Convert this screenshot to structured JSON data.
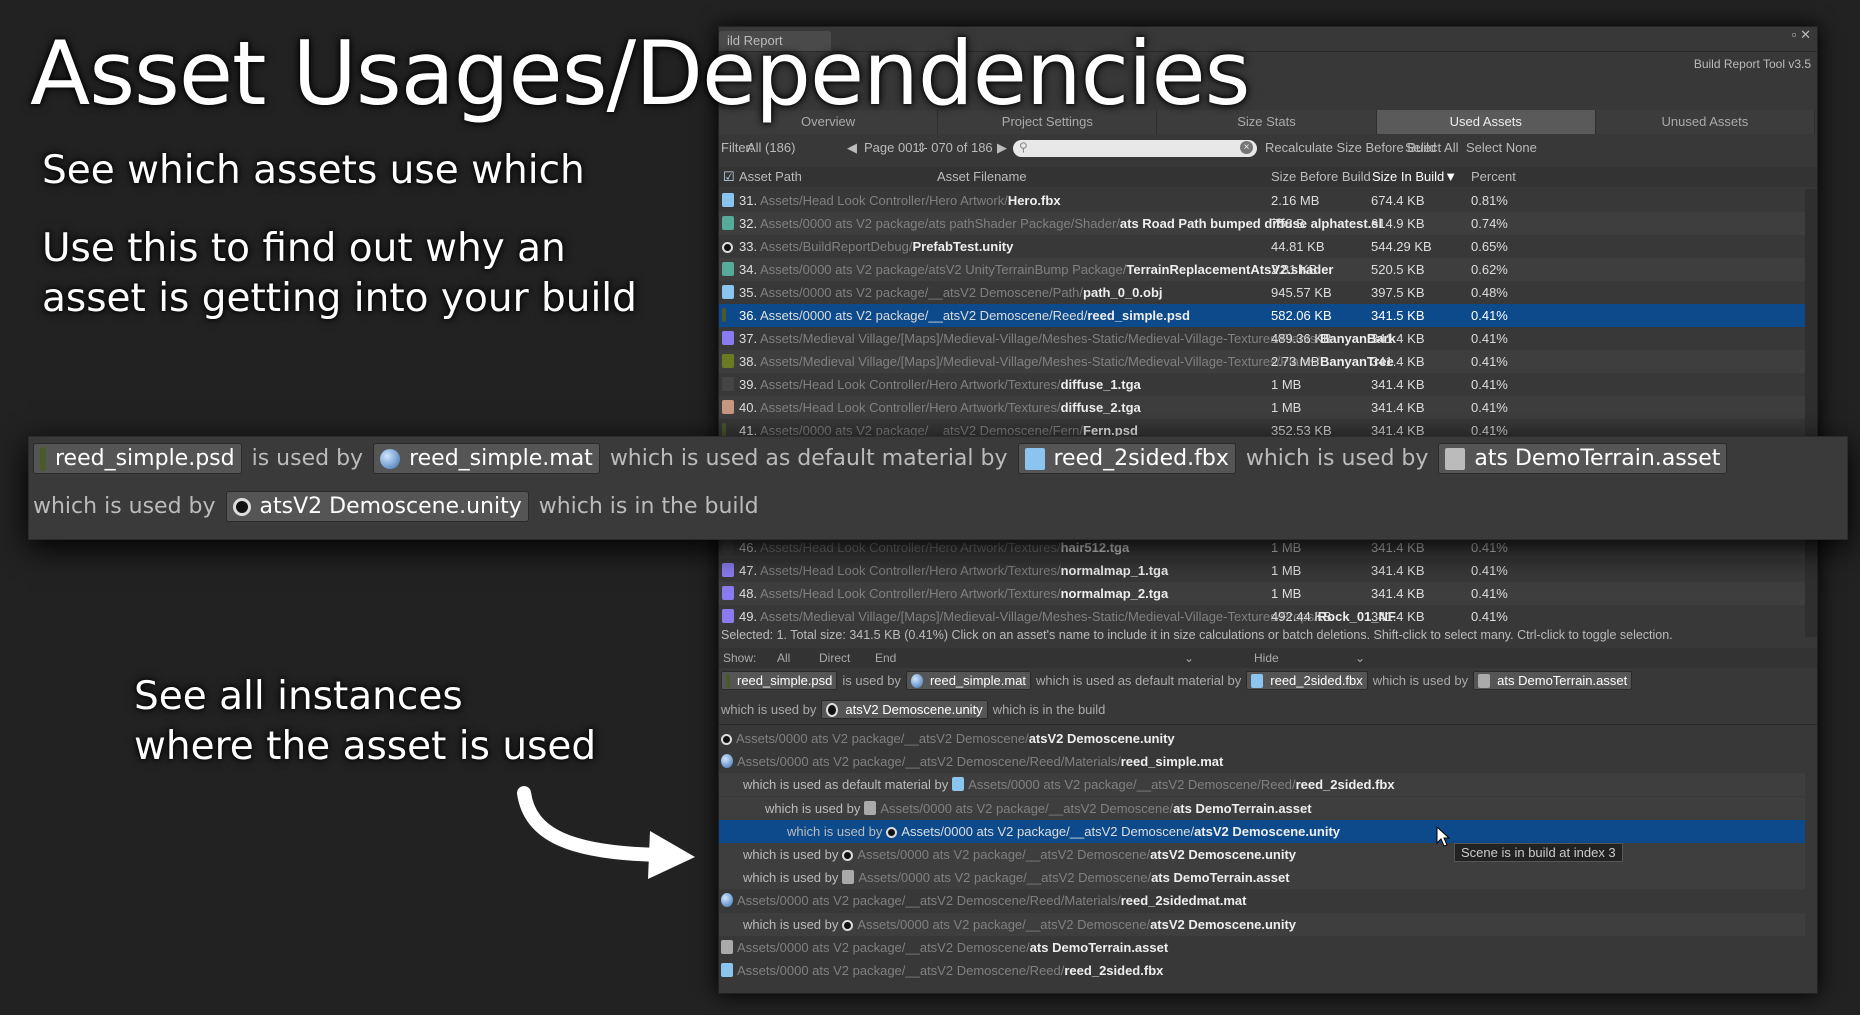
{
  "promo": {
    "title": "Asset Usages/Dependencies",
    "line1": "See which assets use which",
    "line2a": "Use this to find out why an",
    "line2b": "asset is getting into your build",
    "line3a": "See all instances",
    "line3b": "where the asset is used"
  },
  "window": {
    "tab": "ild Report",
    "version": "Build Report Tool v3.5",
    "tabs": [
      {
        "label": "Overview"
      },
      {
        "label": "Project Settings"
      },
      {
        "label": "Size Stats"
      },
      {
        "label": "Used Assets",
        "active": true
      },
      {
        "label": "Unused Assets"
      }
    ],
    "filter_label": "Filter:",
    "filter_value": "All (186)",
    "page": "Page 001 - 070 of 186",
    "search_placeholder": "",
    "recalc": "Recalculate Size Before Build",
    "select_all": "Select All",
    "select_none": "Select None",
    "columns": {
      "path": "Asset Path",
      "filename": "Asset Filename",
      "before": "Size Before Build",
      "inbuild": "Size In Build",
      "percent": "Percent"
    }
  },
  "rows": [
    {
      "n": "31.",
      "icon": "fbx",
      "dir": "Assets/Head Look Controller/Hero Artwork/",
      "file": "Hero.fbx",
      "before": "2.16 MB",
      "inbuild": "674.4 KB",
      "pct": "0.81%"
    },
    {
      "n": "32.",
      "icon": "shader",
      "dir": "Assets/0000 ats V2 package/ats pathShader Package/Shader/",
      "file": "ats Road Path bumped diffuse alphatest.sl",
      "before": "758 B",
      "inbuild": "614.9 KB",
      "pct": "0.74%"
    },
    {
      "n": "33.",
      "icon": "unity",
      "dir": "Assets/BuildReportDebug/",
      "file": "PrefabTest.unity",
      "before": "44.81 KB",
      "inbuild": "544.29 KB",
      "pct": "0.65%"
    },
    {
      "n": "34.",
      "icon": "shader",
      "dir": "Assets/0000 ats V2 package/atsV2 UnityTerrainBump Package/",
      "file": "TerrainReplacementAtsV2.shader",
      "before": "2.81 KB",
      "inbuild": "520.5 KB",
      "pct": "0.62%"
    },
    {
      "n": "35.",
      "icon": "fbx",
      "dir": "Assets/0000 ats V2 package/__atsV2 Demoscene/Path/",
      "file": "path_0_0.obj",
      "before": "945.57 KB",
      "inbuild": "397.5 KB",
      "pct": "0.48%"
    },
    {
      "n": "36.",
      "icon": "psd",
      "dir": "Assets/0000 ats V2 package/__atsV2 Demoscene/Reed/",
      "file": "reed_simple.psd",
      "before": "582.06 KB",
      "inbuild": "341.5 KB",
      "pct": "0.41%",
      "selected": true
    },
    {
      "n": "37.",
      "icon": "tex",
      "dir": "Assets/Medieval Village/[Maps]/Medieval-Village/Meshes-Static/Medieval-Village-Textures/Plants/",
      "file": "BanyanBark",
      "before": "489.36 KB",
      "inbuild": "341.4 KB",
      "pct": "0.41%"
    },
    {
      "n": "38.",
      "icon": "tex2",
      "dir": "Assets/Medieval Village/[Maps]/Medieval-Village/Meshes-Static/Medieval-Village-Textures/Plants/",
      "file": "BanyanTree",
      "before": "2.73 MB",
      "inbuild": "341.4 KB",
      "pct": "0.41%"
    },
    {
      "n": "39.",
      "icon": "tex3",
      "dir": "Assets/Head Look Controller/Hero Artwork/Textures/",
      "file": "diffuse_1.tga",
      "before": "1 MB",
      "inbuild": "341.4 KB",
      "pct": "0.41%"
    },
    {
      "n": "40.",
      "icon": "tex4",
      "dir": "Assets/Head Look Controller/Hero Artwork/Textures/",
      "file": "diffuse_2.tga",
      "before": "1 MB",
      "inbuild": "341.4 KB",
      "pct": "0.41%"
    },
    {
      "n": "41.",
      "icon": "psd",
      "dir": "Assets/0000 ats V2 package/__atsV2 Demoscene/Fern/",
      "file": "Fern.psd",
      "before": "352.53 KB",
      "inbuild": "341.4 KB",
      "pct": "0.41%"
    },
    {
      "n": "46.",
      "icon": "tex3",
      "dir": "Assets/Head Look Controller/Hero Artwork/Textures/",
      "file": "hair512.tga",
      "before": "1 MB",
      "inbuild": "341.4 KB",
      "pct": "0.41%"
    },
    {
      "n": "47.",
      "icon": "tex",
      "dir": "Assets/Head Look Controller/Hero Artwork/Textures/",
      "file": "normalmap_1.tga",
      "before": "1 MB",
      "inbuild": "341.4 KB",
      "pct": "0.41%"
    },
    {
      "n": "48.",
      "icon": "tex",
      "dir": "Assets/Head Look Controller/Hero Artwork/Textures/",
      "file": "normalmap_2.tga",
      "before": "1 MB",
      "inbuild": "341.4 KB",
      "pct": "0.41%"
    },
    {
      "n": "49.",
      "icon": "tex",
      "dir": "Assets/Medieval Village/[Maps]/Medieval-Village/Meshes-Static/Medieval-Village-Textures/Props/",
      "file": "Rock_01_NF",
      "before": "492.44 KB",
      "inbuild": "341.4 KB",
      "pct": "0.41%"
    }
  ],
  "status": "Selected: 1. Total size: 341.5 KB (0.41%)      Click on an asset's name to include it in size calculations or batch deletions. Shift-click to select many. Ctrl-click to toggle selection.",
  "show": {
    "label": "Show:",
    "all": "All",
    "direct": "Direct",
    "end": "End",
    "hide": "Hide"
  },
  "chain": {
    "a": "reed_simple.psd",
    "t1": "is used by",
    "b": "reed_simple.mat",
    "t2": "which is used as default material by",
    "c": "reed_2sided.fbx",
    "t3": "which is used by",
    "d": "ats DemoTerrain.asset",
    "t4": "which is used by",
    "e": "atsV2 Demoscene.unity",
    "t5": "which is in the build"
  },
  "tree": [
    {
      "lvl": 0,
      "pre": "",
      "icon": "unity",
      "dir": "Assets/0000 ats V2 package/__atsV2 Demoscene/",
      "file": "atsV2 Demoscene.unity"
    },
    {
      "lvl": 0,
      "pre": "",
      "icon": "mat",
      "dir": "Assets/0000 ats V2 package/__atsV2 Demoscene/Reed/Materials/",
      "file": "reed_simple.mat"
    },
    {
      "lvl": 1,
      "pre": "which is used as default material by",
      "icon": "fbx",
      "dir": "Assets/0000 ats V2 package/__atsV2 Demoscene/Reed/",
      "file": "reed_2sided.fbx"
    },
    {
      "lvl": 2,
      "pre": "which is used by",
      "icon": "asset",
      "dir": "Assets/0000 ats V2 package/__atsV2 Demoscene/",
      "file": "ats DemoTerrain.asset"
    },
    {
      "lvl": 3,
      "pre": "which is used by",
      "icon": "unity",
      "dir": "Assets/0000 ats V2 package/__atsV2 Demoscene/",
      "file": "atsV2 Demoscene.unity",
      "selected": true
    },
    {
      "lvl": 1,
      "pre": "which is used by",
      "icon": "unity",
      "dir": "Assets/0000 ats V2 package/__atsV2 Demoscene/",
      "file": "atsV2 Demoscene.unity"
    },
    {
      "lvl": 1,
      "pre": "which is used by",
      "icon": "asset",
      "dir": "Assets/0000 ats V2 package/__atsV2 Demoscene/",
      "file": "ats DemoTerrain.asset"
    },
    {
      "lvl": 0,
      "pre": "",
      "icon": "mat",
      "dir": "Assets/0000 ats V2 package/__atsV2 Demoscene/Reed/Materials/",
      "file": "reed_2sidedmat.mat"
    },
    {
      "lvl": 1,
      "pre": "which is used by",
      "icon": "unity",
      "dir": "Assets/0000 ats V2 package/__atsV2 Demoscene/",
      "file": "atsV2 Demoscene.unity"
    },
    {
      "lvl": 0,
      "pre": "",
      "icon": "asset",
      "dir": "Assets/0000 ats V2 package/__atsV2 Demoscene/",
      "file": "ats DemoTerrain.asset"
    },
    {
      "lvl": 0,
      "pre": "",
      "icon": "fbx",
      "dir": "Assets/0000 ats V2 package/__atsV2 Demoscene/Reed/",
      "file": "reed_2sided.fbx"
    }
  ],
  "tooltip": "Scene is in build at index 3",
  "colors": {
    "selection": "#0c4a8c",
    "background": "#222222",
    "panel": "#383838"
  }
}
